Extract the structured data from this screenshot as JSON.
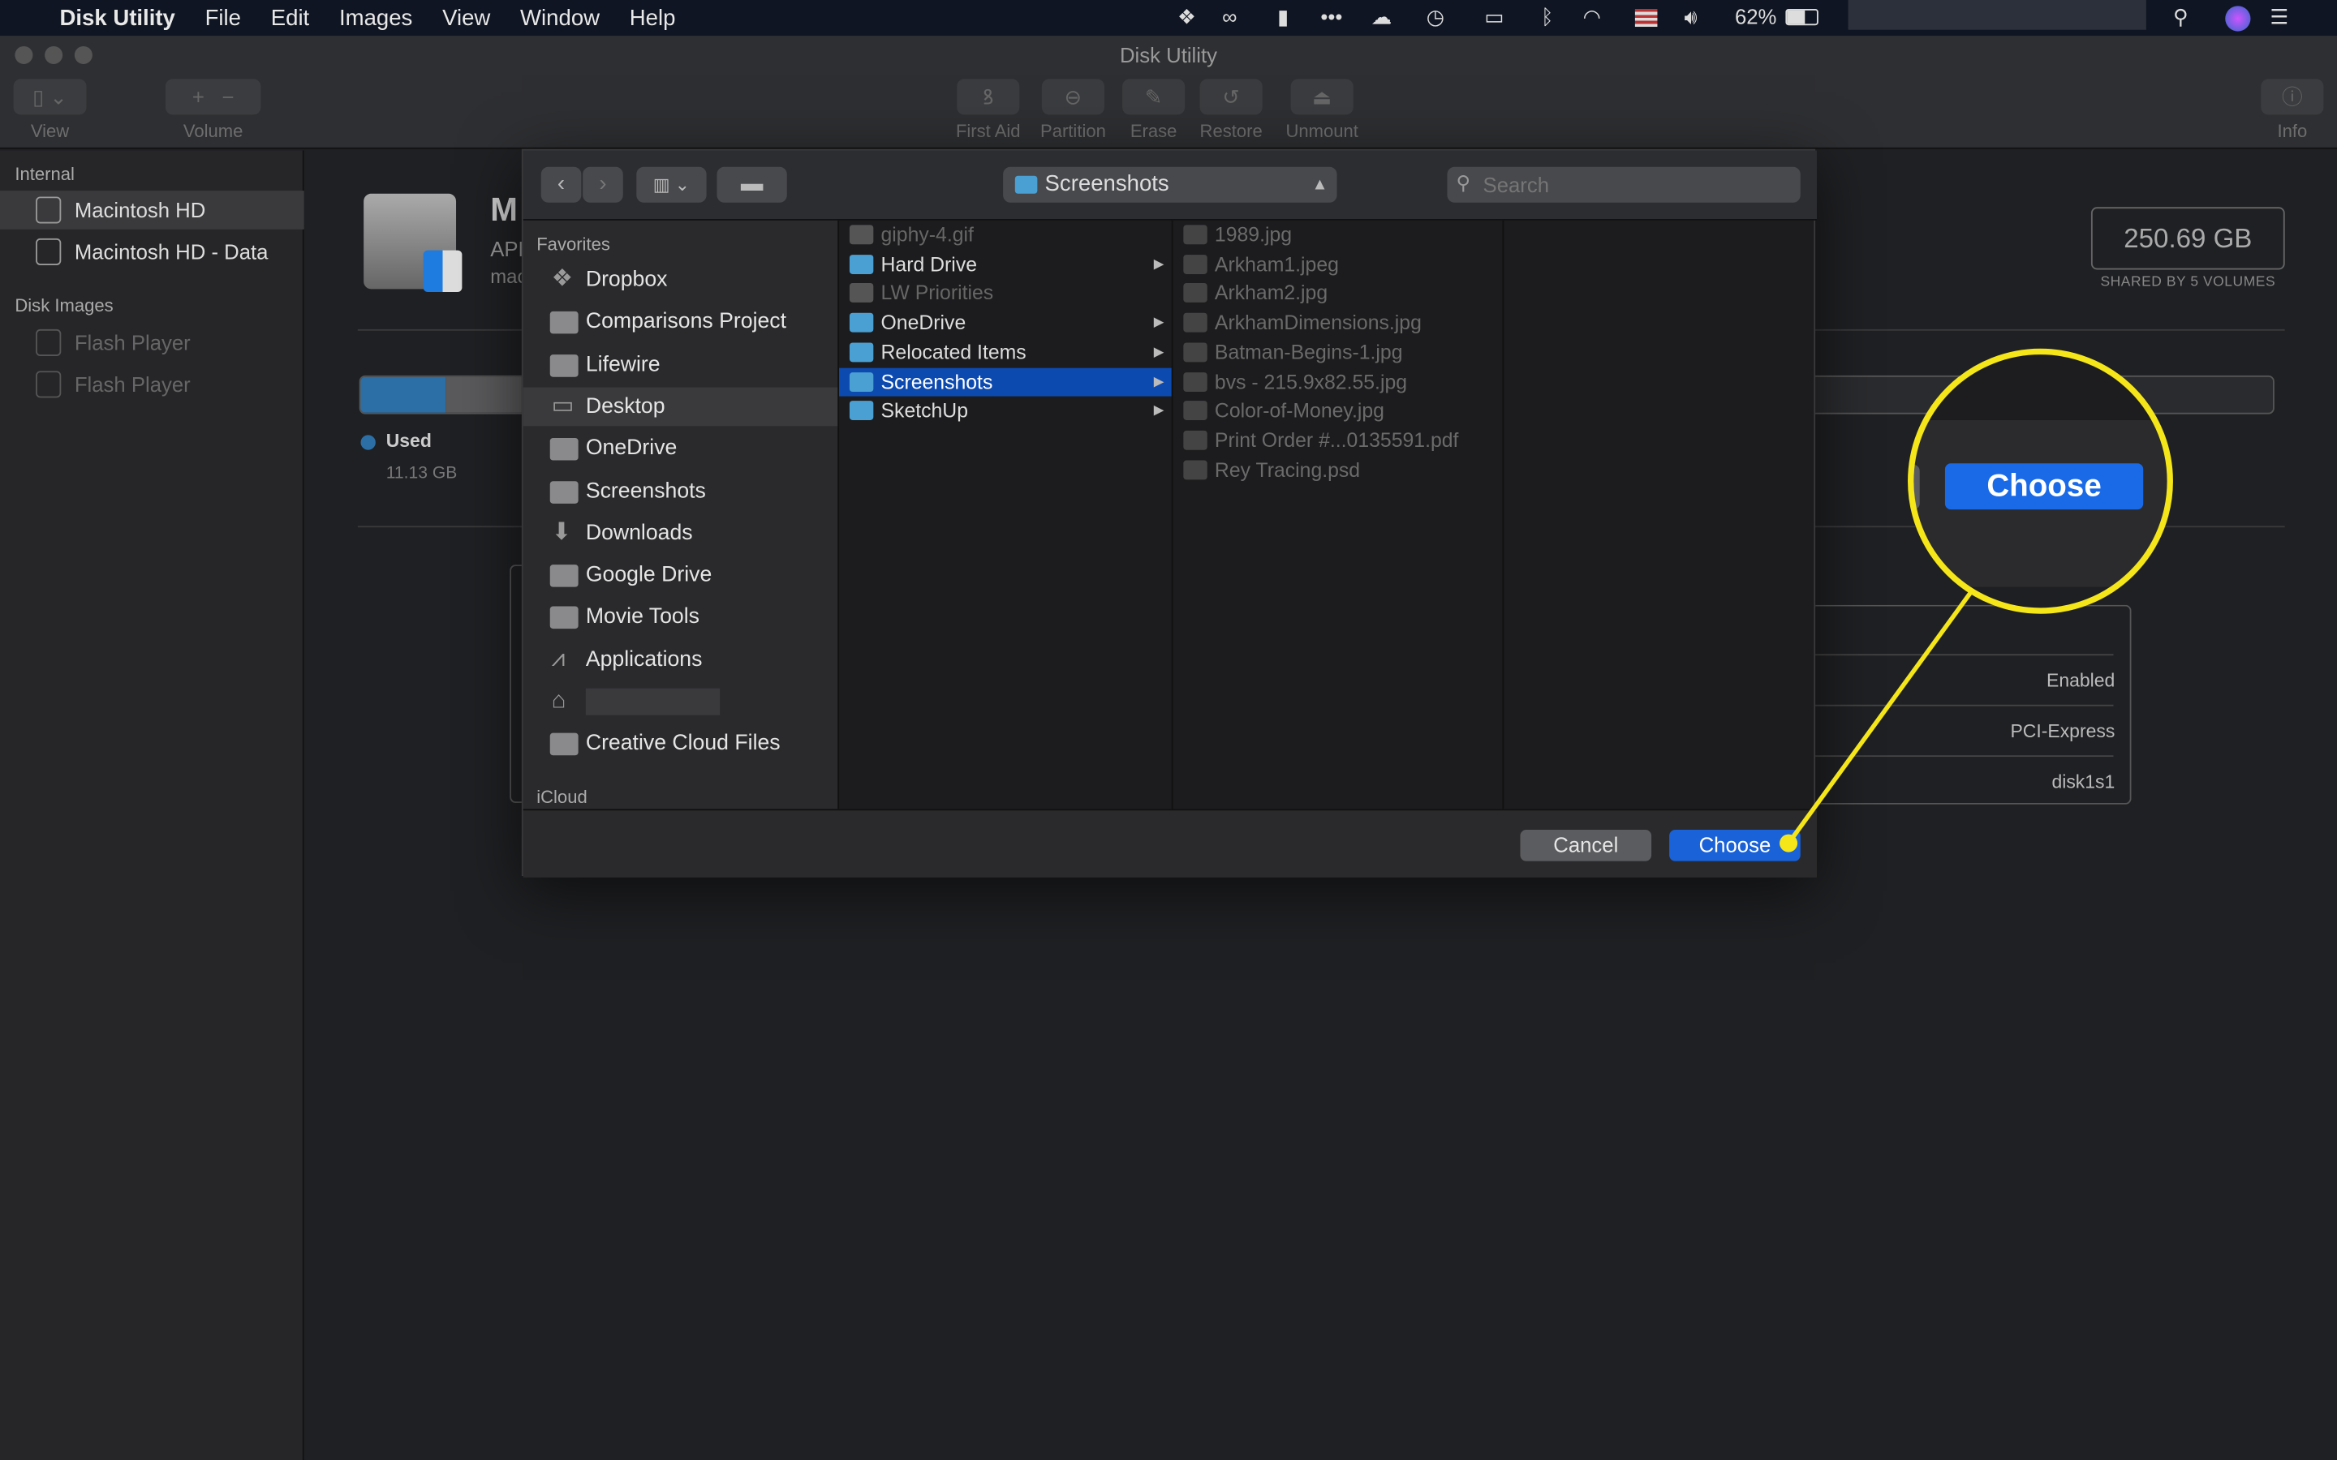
{
  "menubar": {
    "app": "Disk Utility",
    "items": [
      "File",
      "Edit",
      "Images",
      "View",
      "Window",
      "Help"
    ],
    "battery": "62%",
    "status_icons": [
      "dropbox-icon",
      "creative-cloud-icon",
      "notification-icon",
      "more-icon",
      "cloud-upload-icon",
      "time-machine-icon",
      "airplay-icon",
      "bluetooth-icon",
      "wifi-icon",
      "us-flag-icon",
      "volume-icon"
    ]
  },
  "window": {
    "title": "Disk Utility",
    "toolbar": {
      "view": "View",
      "volume": "Volume",
      "first_aid": "First Aid",
      "partition": "Partition",
      "erase": "Erase",
      "restore": "Restore",
      "unmount": "Unmount",
      "info": "Info"
    }
  },
  "sidebar": {
    "internal_header": "Internal",
    "internal": [
      "Macintosh HD",
      "Macintosh HD - Data"
    ],
    "images_header": "Disk Images",
    "images": [
      "Flash Player",
      "Flash Player"
    ]
  },
  "main": {
    "title_partial": "M",
    "subtitle_partial": "APF",
    "sub2_partial": "mac",
    "capacity": "250.69 GB",
    "capacity_note": "SHARED BY 5 VOLUMES",
    "used_label": "Used",
    "used_value": "11.13 GB",
    "used_fraction": 0.044,
    "info_rows": [
      "Enabled",
      "PCI-Express",
      "disk1s1"
    ]
  },
  "dialog": {
    "path": "Screenshots",
    "search_placeholder": "Search",
    "favorites_header": "Favorites",
    "favorites": [
      {
        "label": "Dropbox",
        "icon": "dropbox-icon"
      },
      {
        "label": "Comparisons Project",
        "icon": "folder-icon"
      },
      {
        "label": "Lifewire",
        "icon": "folder-icon"
      },
      {
        "label": "Desktop",
        "icon": "desktop-icon",
        "selected": true
      },
      {
        "label": "OneDrive",
        "icon": "folder-icon"
      },
      {
        "label": "Screenshots",
        "icon": "folder-icon"
      },
      {
        "label": "Downloads",
        "icon": "downloads-icon"
      },
      {
        "label": "Google Drive",
        "icon": "folder-icon"
      },
      {
        "label": "Movie Tools",
        "icon": "folder-icon"
      },
      {
        "label": "Applications",
        "icon": "applications-icon"
      },
      {
        "label": "",
        "icon": "home-icon"
      },
      {
        "label": "Creative Cloud Files",
        "icon": "folder-icon"
      }
    ],
    "icloud_header": "iCloud",
    "column1": [
      {
        "label": "giphy-4.gif",
        "dim": true
      },
      {
        "label": "Hard Drive",
        "folder": true,
        "arrow": true
      },
      {
        "label": "LW Priorities",
        "dim": true
      },
      {
        "label": "OneDrive",
        "folder": true,
        "arrow": true
      },
      {
        "label": "Relocated Items",
        "folder": true,
        "arrow": true
      },
      {
        "label": "Screenshots",
        "folder": true,
        "arrow": true,
        "selected": true
      },
      {
        "label": "SketchUp",
        "folder": true,
        "arrow": true
      }
    ],
    "column2": [
      "1989.jpg",
      "Arkham1.jpeg",
      "Arkham2.jpg",
      "ArkhamDimensions.jpg",
      "Batman-Begins-1.jpg",
      "bvs - 215.9x82.55.jpg",
      "Color-of-Money.jpg",
      "Print Order #...0135591.pdf",
      "Rey Tracing.psd"
    ],
    "cancel": "Cancel",
    "choose": "Choose"
  },
  "callout": {
    "label": "Choose",
    "color": "#f5e61a",
    "button_color": "#1a6ae8"
  },
  "colors": {
    "accent": "#0d4ab0",
    "menubar": "#0f1522"
  }
}
